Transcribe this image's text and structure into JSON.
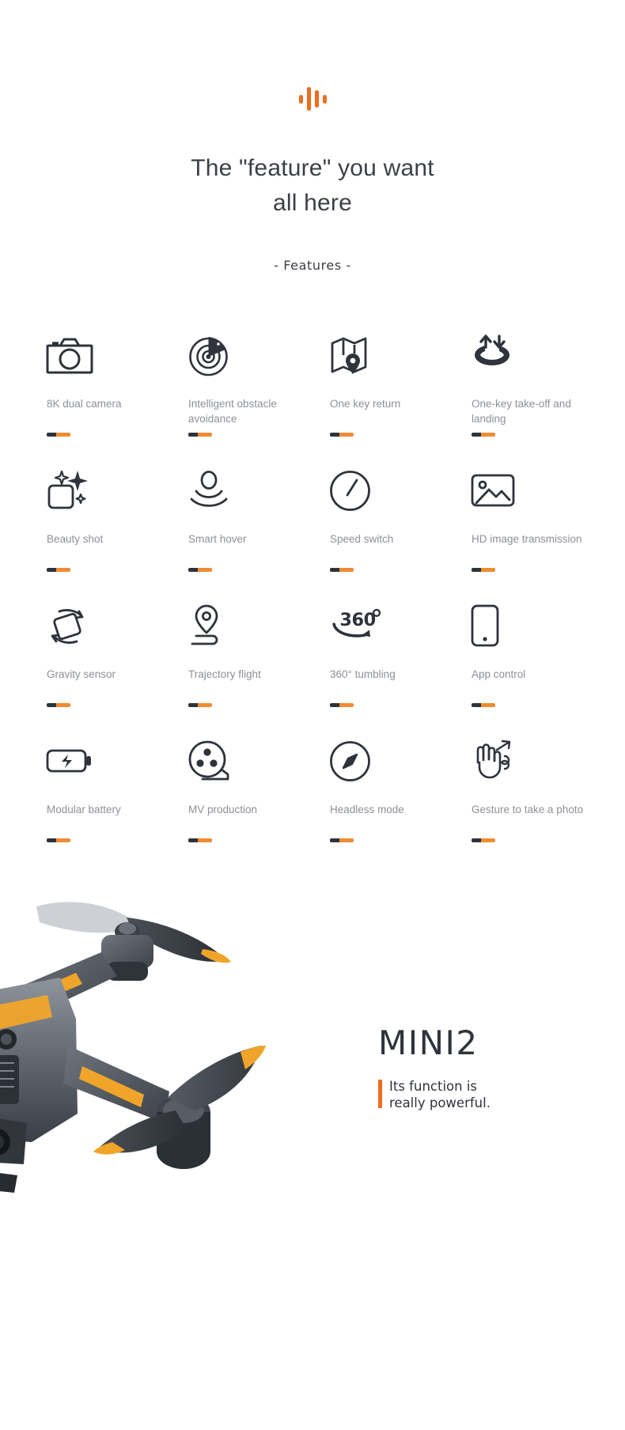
{
  "header": {
    "logo_icon": "sound-wave-icon",
    "headline_line1": "The \"feature\" you want",
    "headline_line2": "all here",
    "subtitle": "- Features -"
  },
  "theme": {
    "accent_orange": "#ef6c1f",
    "bar_orange": "#ef8b33",
    "bar_dark": "#2f333b",
    "text_dark": "#3b3f46",
    "text_muted": "#8c9096",
    "background": "#ffffff"
  },
  "features": [
    {
      "label": "8K dual camera",
      "icon": "camera-icon"
    },
    {
      "label": "Intelligent obstacle avoidance",
      "icon": "radar-icon"
    },
    {
      "label": "One key return",
      "icon": "map-pin-icon"
    },
    {
      "label": "One-key take-off and landing",
      "icon": "takeoff-landing-icon"
    },
    {
      "label": "Beauty shot",
      "icon": "sparkle-frame-icon"
    },
    {
      "label": "Smart hover",
      "icon": "hover-icon"
    },
    {
      "label": "Speed switch",
      "icon": "speedometer-icon"
    },
    {
      "label": "HD image transmission",
      "icon": "photo-icon"
    },
    {
      "label": "Gravity sensor",
      "icon": "gravity-tilt-icon"
    },
    {
      "label": "Trajectory flight",
      "icon": "trajectory-pin-icon"
    },
    {
      "label": "360° tumbling",
      "icon": "flip-360-icon"
    },
    {
      "label": "App control",
      "icon": "phone-icon"
    },
    {
      "label": "Modular battery",
      "icon": "battery-icon"
    },
    {
      "label": "MV production",
      "icon": "film-reel-icon"
    },
    {
      "label": "Headless mode",
      "icon": "compass-icon"
    },
    {
      "label": "Gesture to take a photo",
      "icon": "hand-gesture-icon"
    }
  ],
  "branding": {
    "product_name": "MINI2",
    "tagline_line1": "Its function is",
    "tagline_line2": "really powerful."
  }
}
